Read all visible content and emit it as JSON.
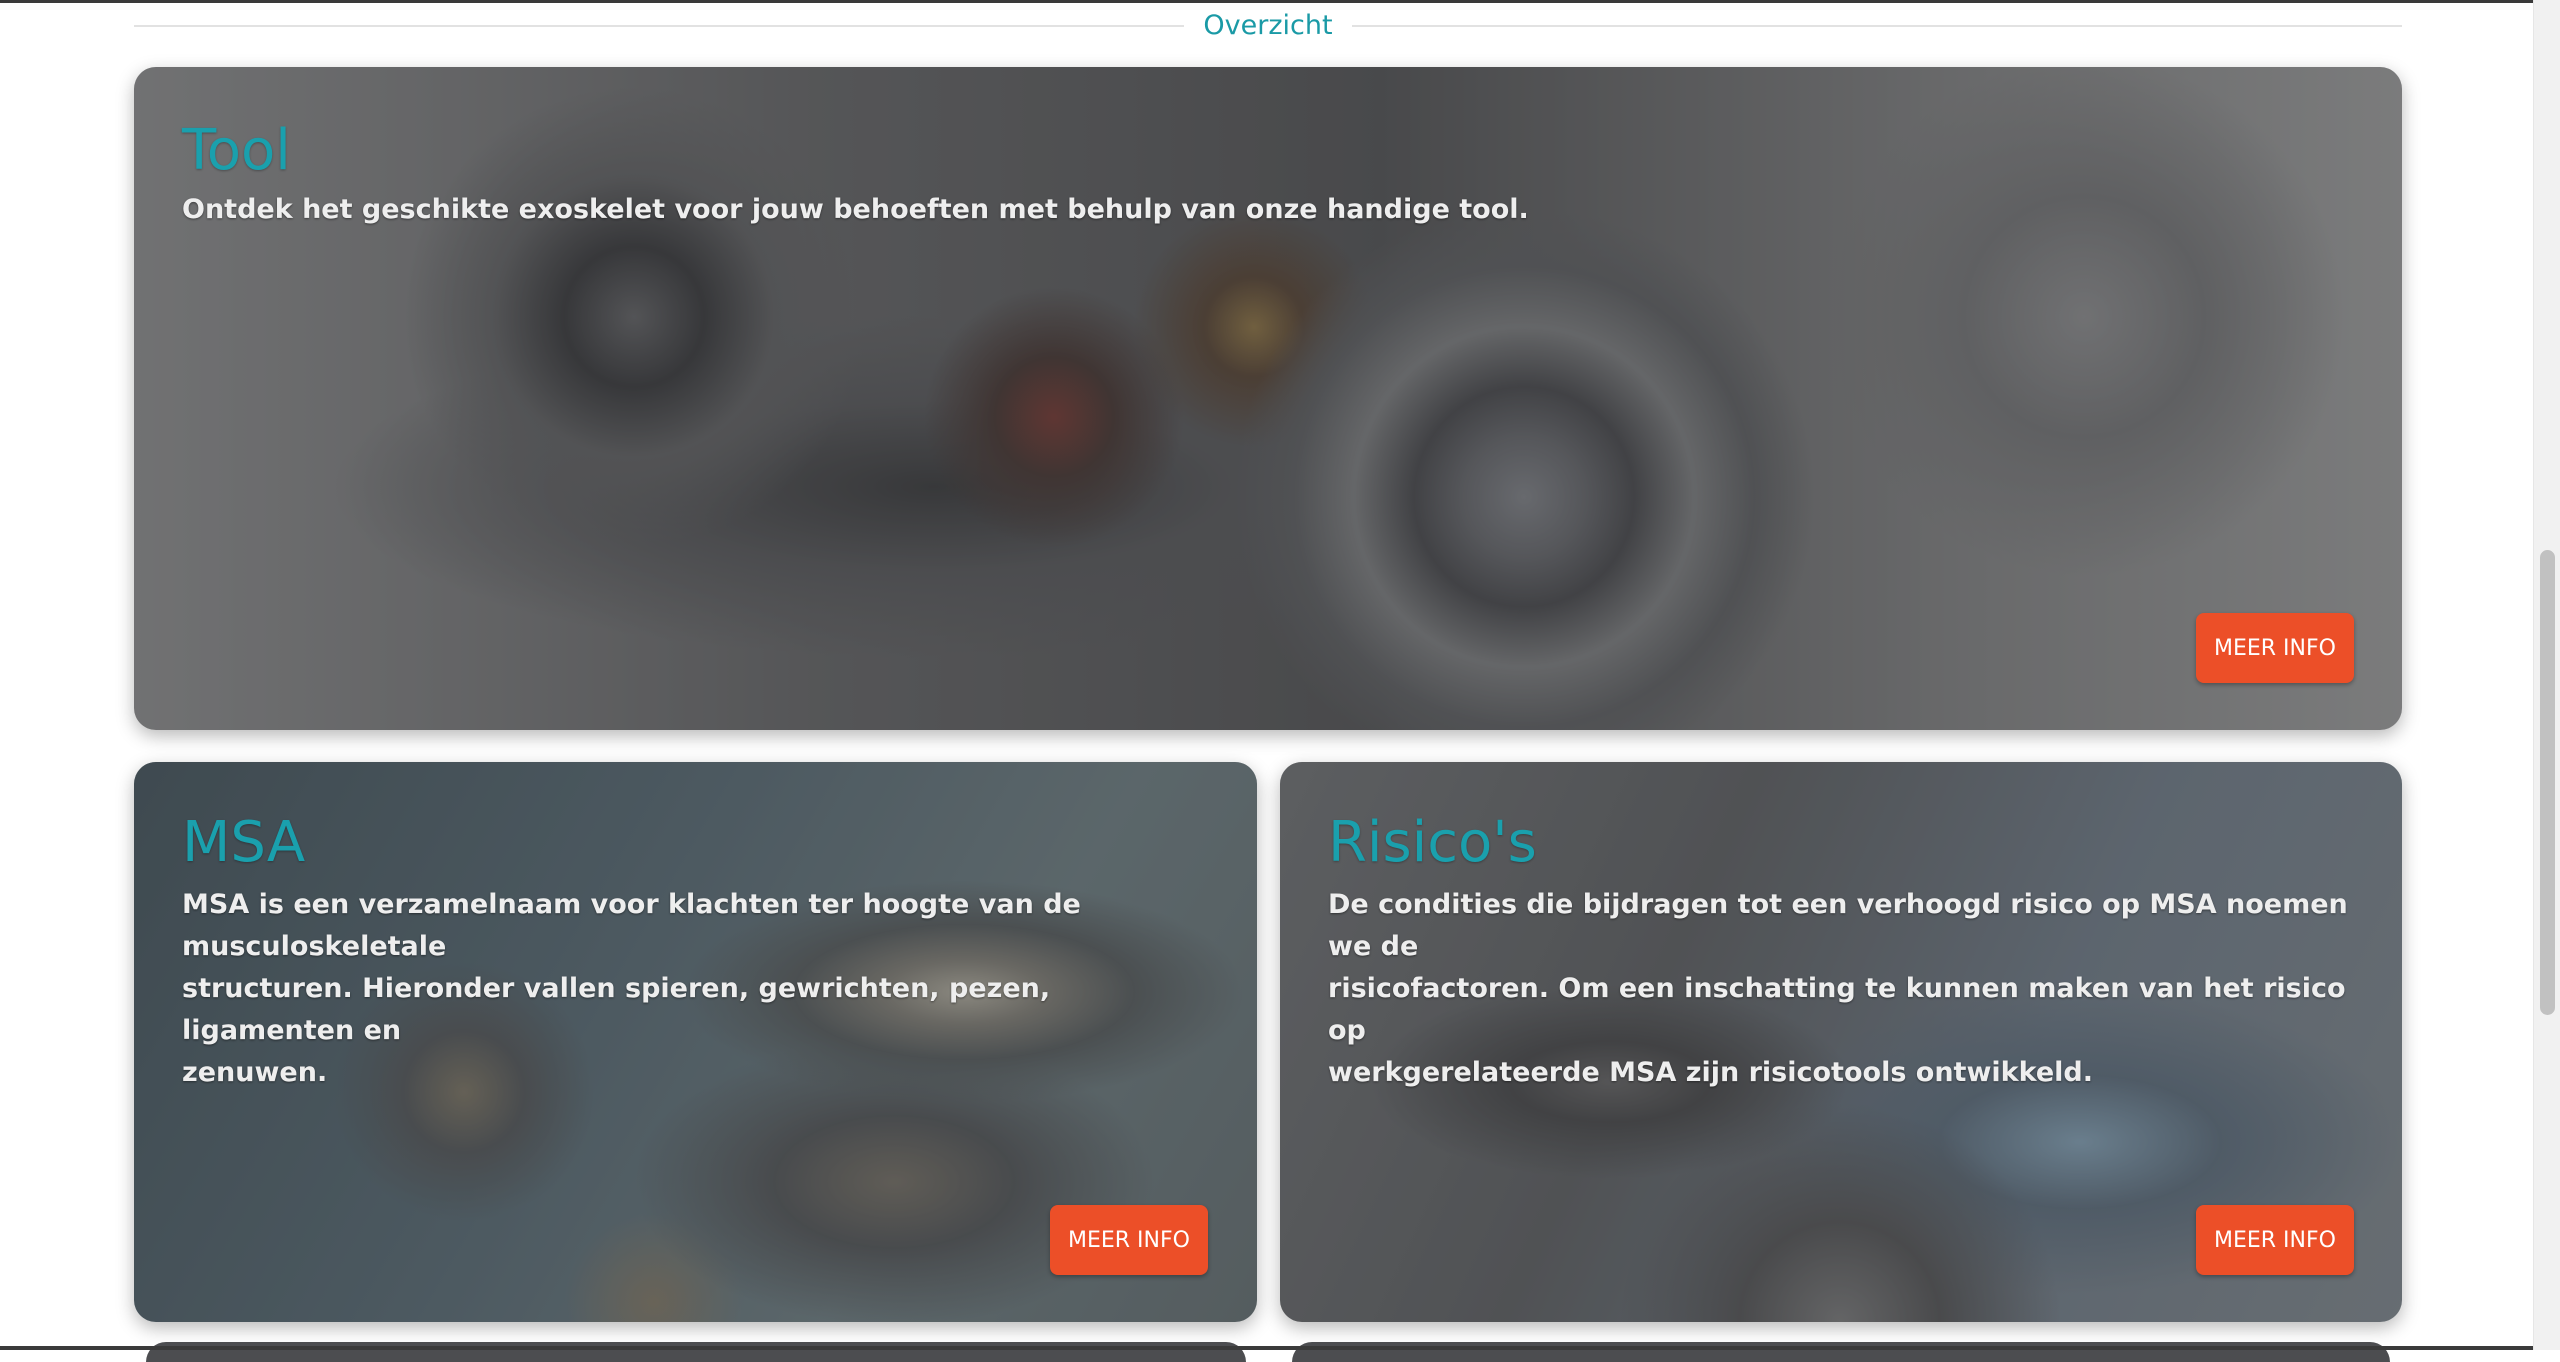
{
  "section": {
    "title": "Overzicht"
  },
  "cards": [
    {
      "title": "Tool",
      "description": "Ontdek het geschikte exoskelet voor jouw behoeften met behulp van onze handige tool.",
      "button_label": "MEER INFO"
    },
    {
      "title": "MSA",
      "description_lines": [
        "MSA is een verzamelnaam voor klachten ter hoogte van de musculoskeletale",
        "structuren. Hieronder vallen spieren, gewrichten, pezen, ligamenten en",
        "zenuwen."
      ],
      "button_label": "MEER INFO"
    },
    {
      "title": "Risico's",
      "description_lines": [
        "De condities die bijdragen tot een verhoogd risico op MSA noemen we de",
        "risicofactoren. Om een inschatting te kunnen maken van het risico op",
        "werkgerelateerde MSA zijn risicotools ontwikkeld."
      ],
      "button_label": "MEER INFO"
    }
  ],
  "colors": {
    "accent_title": "#1aa0ad",
    "button": "#ec4f28",
    "section_title": "#1a9aa6"
  }
}
